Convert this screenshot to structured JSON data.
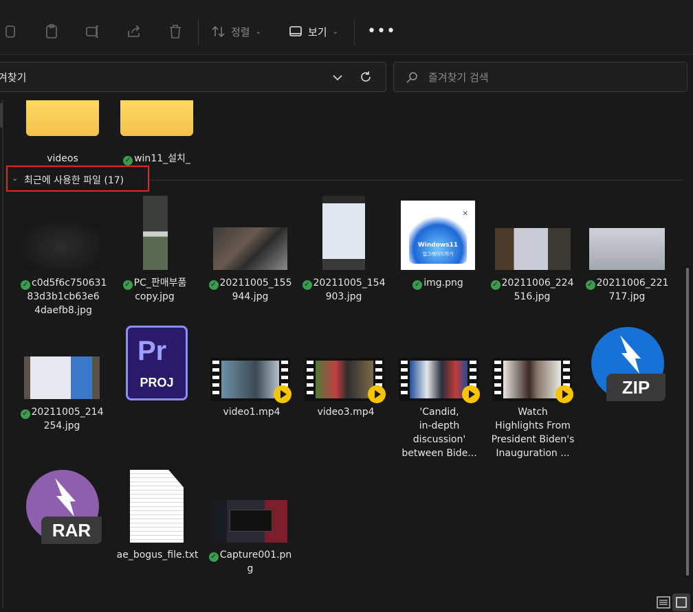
{
  "toolbar": {
    "sort_label": "정렬",
    "view_label": "보기",
    "more_label": "•••"
  },
  "address": {
    "path_text": "겨찾기"
  },
  "search": {
    "placeholder": "즐겨찾기 검색"
  },
  "folders": [
    {
      "name": "videos",
      "synced": false
    },
    {
      "name": "win11_설치_",
      "synced": true
    }
  ],
  "group": {
    "title": "최근에 사용한 파일 (17)"
  },
  "files": [
    {
      "name_lines": [
        "c0d5f6c750631",
        "83d3b1cb63e6",
        "4daefb8.jpg"
      ],
      "synced": true,
      "icon": "image-thumbnail"
    },
    {
      "name_lines": [
        "PC_판매부품",
        "copy.jpg"
      ],
      "synced": true,
      "icon": "image-thumbnail"
    },
    {
      "name_lines": [
        "20211005_155",
        "944.jpg"
      ],
      "synced": true,
      "icon": "image-thumbnail"
    },
    {
      "name_lines": [
        "20211005_154",
        "903.jpg"
      ],
      "synced": true,
      "icon": "image-thumbnail"
    },
    {
      "name_lines": [
        "img.png"
      ],
      "synced": true,
      "icon": "image-thumbnail"
    },
    {
      "name_lines": [
        "20211006_224",
        "516.jpg"
      ],
      "synced": true,
      "icon": "image-thumbnail"
    },
    {
      "name_lines": [
        "20211006_221",
        "717.jpg"
      ],
      "synced": true,
      "icon": "image-thumbnail"
    },
    {
      "name_lines": [
        "20211005_214",
        "254.jpg"
      ],
      "synced": true,
      "icon": "image-thumbnail"
    },
    {
      "name_lines": [],
      "synced": false,
      "icon": "premiere-project-icon"
    },
    {
      "name_lines": [
        "video1.mp4"
      ],
      "synced": false,
      "icon": "video-thumbnail"
    },
    {
      "name_lines": [
        "video3.mp4"
      ],
      "synced": false,
      "icon": "video-thumbnail"
    },
    {
      "name_lines": [
        "'Candid,",
        "in-depth",
        "discussion'",
        "between Bide..."
      ],
      "synced": false,
      "icon": "video-thumbnail"
    },
    {
      "name_lines": [
        "Watch",
        "Highlights From",
        "President Biden's",
        "Inauguration ..."
      ],
      "synced": false,
      "icon": "video-thumbnail"
    },
    {
      "name_lines": [],
      "synced": false,
      "icon": "zip-archive-icon"
    },
    {
      "name_lines": [],
      "synced": false,
      "icon": "rar-archive-icon"
    },
    {
      "name_lines": [
        "ae_bogus_file.txt"
      ],
      "synced": false,
      "icon": "text-file-icon"
    },
    {
      "name_lines": [
        "Capture001.pn",
        "g"
      ],
      "synced": true,
      "icon": "image-thumbnail"
    }
  ],
  "thumb_text": {
    "img_png_caption_1": "Windows11",
    "img_png_caption_2": "업그레이드하기",
    "pr_text": "Pr",
    "proj_text": "PROJ",
    "zip_text": "ZIP",
    "rar_text": "RAR"
  },
  "colors": {
    "accent_red": "#e0262a",
    "folder_yellow": "#f3c34a",
    "sync_green": "#3b9c4d",
    "play_yellow": "#f8c400"
  }
}
